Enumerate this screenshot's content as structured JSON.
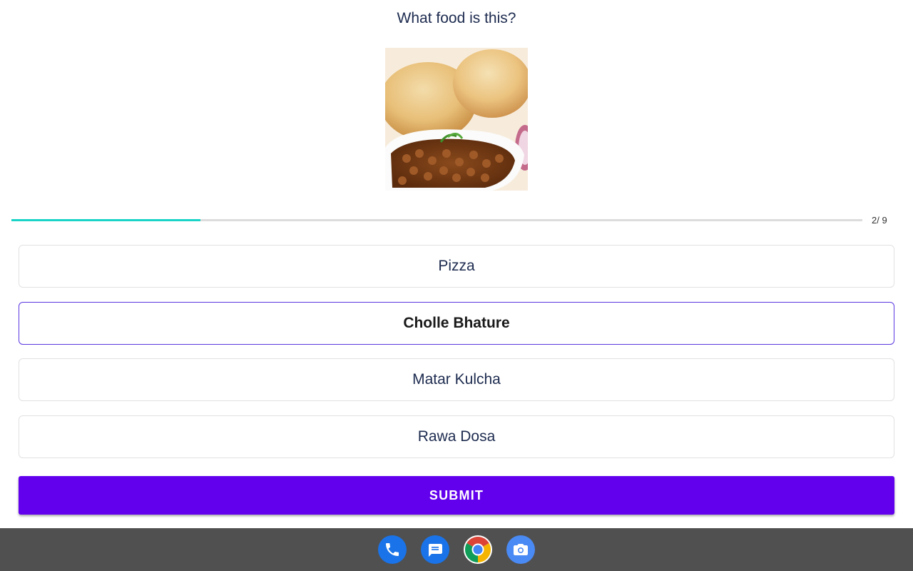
{
  "question": "What food is this?",
  "image": {
    "subject": "chole-bhature-photo"
  },
  "progress": {
    "current": 2,
    "total": 9,
    "fraction": 0.222,
    "text": "2/ 9",
    "color": "#18d3c6"
  },
  "options": [
    {
      "label": "Pizza",
      "selected": false
    },
    {
      "label": "Cholle Bhature",
      "selected": true
    },
    {
      "label": "Matar Kulcha",
      "selected": false
    },
    {
      "label": "Rawa Dosa",
      "selected": false
    }
  ],
  "submit": {
    "label": "SUBMIT",
    "color": "#6200ee"
  },
  "taskbar": {
    "icons": [
      "phone-icon",
      "messages-icon",
      "chrome-icon",
      "camera-icon"
    ],
    "color": "#505050"
  }
}
